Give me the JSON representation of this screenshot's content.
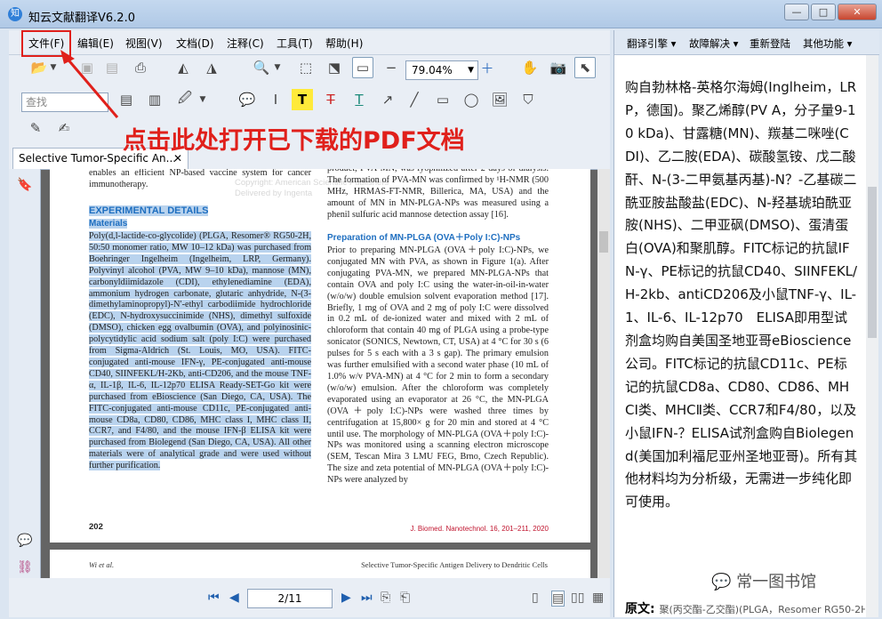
{
  "window": {
    "title": "知云文献翻译V6.2.0",
    "logo": "知",
    "minimize": "—",
    "maximize": "□",
    "close": "✕"
  },
  "menu": [
    "文件(F)",
    "编辑(E)",
    "视图(V)",
    "文档(D)",
    "注释(C)",
    "工具(T)",
    "帮助(H)"
  ],
  "toolbar": {
    "zoom": "79.04%",
    "search_placeholder": "查找"
  },
  "annotation": "点击此处打开已下载的PDF文档",
  "tab": {
    "label": "Selective Tumor-Specific An...",
    "close": "✕"
  },
  "pdf": {
    "c1_intro": "enables an efficient NP-based vaccine system for cancer immunotherapy.",
    "c1_h1": "EXPERIMENTAL DETAILS",
    "c1_h2": "Materials",
    "c1_body": "Poly(d,l-lactide-co-glycolide) (PLGA, Resomer® RG50-2H, 50:50 monomer ratio, MW 10–12 kDa) was purchased from Boehringer Ingelheim (Ingelheim, LRP, Germany). Polyvinyl alcohol (PVA, MW 9–10 kDa), mannose (MN), carbonyldiimidazole (CDI), ethylenediamine (EDA), ammonium hydrogen carbonate, glutaric anhydride, N-(3-dimethylaminopropyl)-N′-ethyl carbodiimide hydrochloride (EDC), N-hydroxysuccinimide (NHS), dimethyl sulfoxide (DMSO), chicken egg ovalbumin (OVA), and polyinosinic-polycytidylic acid sodium salt (poly I:C) were purchased from Sigma-Aldrich (St. Louis, MO, USA). FITC-conjugated anti-mouse IFN-γ, PE-conjugated anti-mouse CD40, SIINFEKL/H-2Kb, anti-CD206, and the mouse TNF-α, IL-1β, IL-6, IL-12p70 ELISA Ready-SET-Go kit were purchased from eBioscience (San Diego, CA, USA). The FITC-conjugated anti-mouse CD11c, PE-conjugated anti-mouse CD8a, CD80, CD86, MHC class I, MHC class II, CCR7, and F4/80, and the mouse IFN-β ELISA kit were purchased from Biolegend (San Diego, CA, USA). All other materials were of analytical grade and were used without further purification.",
    "c2_top": "product, PVA-MN, was lyophilized after 2 days of dialysis. The formation of PVA-MN was confirmed by ¹H-NMR (500 MHz, HRMAS-FT-NMR, Billerica, MA, USA) and the amount of MN in MN-PLGA-NPs was measured using a phenil sulfuric acid mannose detection assay [16].",
    "c2_h": "Preparation of MN-PLGA (OVA＋Poly I:C)-NPs",
    "c2_body": "Prior to preparing MN-PLGA (OVA＋poly I:C)-NPs, we conjugated MN with PVA, as shown in Figure 1(a). After conjugating PVA-MN, we prepared MN-PLGA-NPs that contain OVA and poly I:C using the water-in-oil-in-water (w/o/w) double emulsion solvent evaporation method [17]. Briefly, 1 mg of OVA and 2 mg of poly I:C were dissolved in 0.2 mL of de-ionized water and mixed with 2 mL of chloroform that contain 40 mg of PLGA using a probe-type sonicator (SONICS, Newtown, CT, USA) at 4 °C for 30 s (6 pulses for 5 s each with a 3 s gap). The primary emulsion was further emulsified with a second water phase (10 mL of 1.0% w/v PVA-MN) at 4 °C for 2 min to form a secondary (w/o/w) emulsion. After the chloroform was completely evaporated using an evaporator at 26 °C, the MN-PLGA (OVA＋poly I:C)-NPs were washed three times by centrifugation at 15,800× g for 20 min and stored at 4 °C until use. The morphology of MN-PLGA (OVA＋poly I:C)-NPs was monitored using a scanning electron microscope (SEM, Tescan Mira 3 LMU FEG, Brno, Czech Republic). The size and zeta potential of MN-PLGA (OVA＋poly I:C)-NPs were analyzed by",
    "page_no": "202",
    "journal": "J. Biomed. Nanotechnol. 16, 201–211, 2020",
    "watermark": "Copyright: American Scientific Publishers\nDelivered by Ingenta",
    "p2_left": "Wi et al.",
    "p2_right": "Selective Tumor-Specific Antigen Delivery to Dendritic Cells"
  },
  "nav": {
    "page": "2/11"
  },
  "right": {
    "buttons": [
      "翻译引擎 ▾",
      "故障解决 ▾",
      "重新登陆",
      "其他功能 ▾"
    ],
    "text": "购自勃林格-英格尔海姆(Inglheim，LRP，德国)。聚乙烯醇(PV A，分子量9-10 kDa)、甘露糖(MN)、羰基二咪唑(CDI)、乙二胺(EDA)、碳酸氢铵、戊二酸酐、N-(3-二甲氨基丙基)-N？-乙基碳二酰亚胺盐酸盐(EDC)、N-羟基琥珀酰亚胺(NHS)、二甲亚砜(DMSO)、蛋清蛋白(OVA)和聚肌醇。FITC标记的抗鼠IFN-γ、PE标记的抗鼠CD40、SIINFEKL/H-2kb、antiCD206及小鼠TNF-γ、IL-1、IL-6、IL-12p70　ELISA即用型试剂盒均购自美国圣地亚哥eBioscience公司。FITC标记的抗鼠CD11c、PE标记的抗鼠CD8a、CD80、CD86、MHCⅠ类、MHCⅡ类、CCR7和F4/80，以及小鼠IFN-？ELISA试剂盒购自Biolegend(美国加利福尼亚州圣地亚哥)。所有其他材料均为分析级，无需进一步纯化即可使用。",
    "original_label": "原文:",
    "original_snippet": "聚(丙交酯-乙交酯)(PLGA，Resomer RG50-2H"
  },
  "watermark_brand": "常一图书馆"
}
